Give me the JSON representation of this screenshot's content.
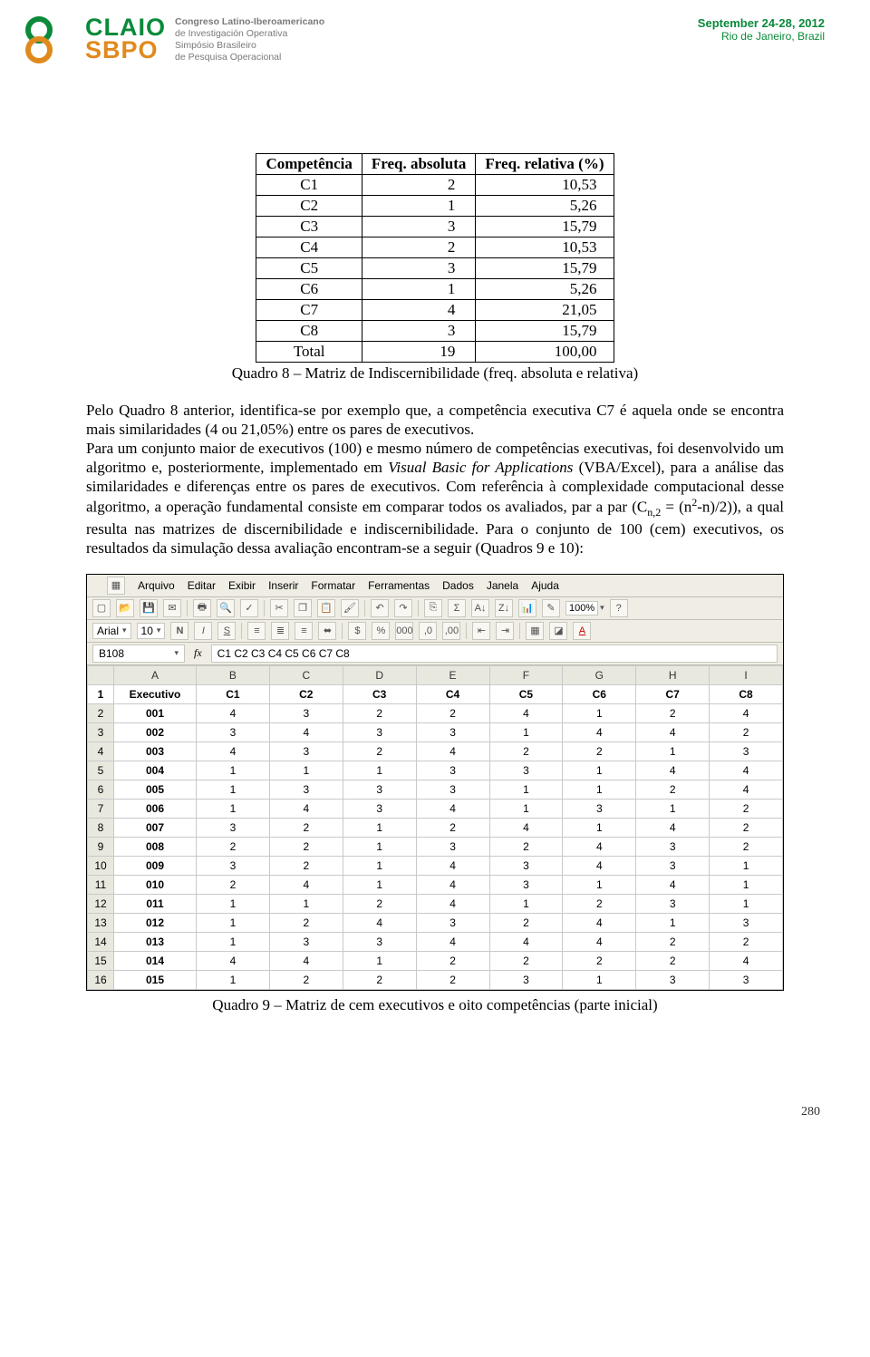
{
  "header": {
    "logo_line1": "CLAIO",
    "logo_line2": "SBPO",
    "sub1": "Congreso Latino-Iberoamericano",
    "sub2": "de Investigación Operativa",
    "sub3": "Simpósio Brasileiro",
    "sub4": "de Pesquisa Operacional",
    "date": "September 24-28, 2012",
    "location": "Rio de Janeiro, Brazil"
  },
  "freq_table": {
    "headers": [
      "Competência",
      "Freq. absoluta",
      "Freq. relativa (%)"
    ],
    "rows": [
      [
        "C1",
        "2",
        "10,53"
      ],
      [
        "C2",
        "1",
        "5,26"
      ],
      [
        "C3",
        "3",
        "15,79"
      ],
      [
        "C4",
        "2",
        "10,53"
      ],
      [
        "C5",
        "3",
        "15,79"
      ],
      [
        "C6",
        "1",
        "5,26"
      ],
      [
        "C7",
        "4",
        "21,05"
      ],
      [
        "C8",
        "3",
        "15,79"
      ],
      [
        "Total",
        "19",
        "100,00"
      ]
    ],
    "caption": "Quadro 8 – Matriz de Indiscernibilidade (freq. absoluta e relativa)"
  },
  "paragraph": {
    "p1a": "Pelo Quadro 8 anterior, identifica-se por exemplo que, a competência executiva C7 é aquela onde se encontra mais similaridades (4 ou 21,05%) entre os pares de executivos.",
    "p1b_pre": "Para um conjunto maior de executivos (100) e mesmo número de competências executivas, foi desenvolvido um algoritmo e, posteriormente, implementado em ",
    "p1b_em": "Visual Basic for Applications",
    "p1b_post": " (VBA/Excel), para a análise das similaridades e diferenças entre os pares de executivos. Com referência à complexidade computacional desse algoritmo, a operação fundamental consiste em comparar todos os avaliados, par a par (C",
    "p1b_sub": "n,2",
    "p1b_mid": " = (n",
    "p1b_sup": "2",
    "p1b_tail": "-n)/2)), a qual resulta nas matrizes de discernibilidade e indiscernibilidade. Para o conjunto de 100 (cem) executivos, os resultados da simulação dessa avaliação encontram-se a seguir (Quadros 9 e 10):"
  },
  "spreadsheet": {
    "menus": [
      "Arquivo",
      "Editar",
      "Exibir",
      "Inserir",
      "Formatar",
      "Ferramentas",
      "Dados",
      "Janela",
      "Ajuda"
    ],
    "font": "Arial",
    "size": "10",
    "zoom": "100%",
    "name_box": "B108",
    "formula": "C1 C2 C3 C4 C5 C6 C7 C8",
    "col_letters": [
      "",
      "A",
      "B",
      "C",
      "D",
      "E",
      "F",
      "G",
      "H",
      "I"
    ],
    "header_row": [
      "Executivo",
      "C1",
      "C2",
      "C3",
      "C4",
      "C5",
      "C6",
      "C7",
      "C8"
    ],
    "data_rows": [
      [
        "001",
        "4",
        "3",
        "2",
        "2",
        "4",
        "1",
        "2",
        "4"
      ],
      [
        "002",
        "3",
        "4",
        "3",
        "3",
        "1",
        "4",
        "4",
        "2"
      ],
      [
        "003",
        "4",
        "3",
        "2",
        "4",
        "2",
        "2",
        "1",
        "3"
      ],
      [
        "004",
        "1",
        "1",
        "1",
        "3",
        "3",
        "1",
        "4",
        "4"
      ],
      [
        "005",
        "1",
        "3",
        "3",
        "3",
        "1",
        "1",
        "2",
        "4"
      ],
      [
        "006",
        "1",
        "4",
        "3",
        "4",
        "1",
        "3",
        "1",
        "2"
      ],
      [
        "007",
        "3",
        "2",
        "1",
        "2",
        "4",
        "1",
        "4",
        "2"
      ],
      [
        "008",
        "2",
        "2",
        "1",
        "3",
        "2",
        "4",
        "3",
        "2"
      ],
      [
        "009",
        "3",
        "2",
        "1",
        "4",
        "3",
        "4",
        "3",
        "1"
      ],
      [
        "010",
        "2",
        "4",
        "1",
        "4",
        "3",
        "1",
        "4",
        "1"
      ],
      [
        "011",
        "1",
        "1",
        "2",
        "4",
        "1",
        "2",
        "3",
        "1"
      ],
      [
        "012",
        "1",
        "2",
        "4",
        "3",
        "2",
        "4",
        "1",
        "3"
      ],
      [
        "013",
        "1",
        "3",
        "3",
        "4",
        "4",
        "4",
        "2",
        "2"
      ],
      [
        "014",
        "4",
        "4",
        "1",
        "2",
        "2",
        "2",
        "2",
        "4"
      ],
      [
        "015",
        "1",
        "2",
        "2",
        "2",
        "3",
        "1",
        "3",
        "3"
      ]
    ],
    "caption": "Quadro 9 – Matriz de cem executivos e oito competências (parte inicial)"
  },
  "page_number": "280",
  "chart_data": {
    "type": "table",
    "title": "Quadro 8 – Matriz de Indiscernibilidade (freq. absoluta e relativa)",
    "columns": [
      "Competência",
      "Freq. absoluta",
      "Freq. relativa (%)"
    ],
    "rows": [
      {
        "Competência": "C1",
        "Freq. absoluta": 2,
        "Freq. relativa (%)": 10.53
      },
      {
        "Competência": "C2",
        "Freq. absoluta": 1,
        "Freq. relativa (%)": 5.26
      },
      {
        "Competência": "C3",
        "Freq. absoluta": 3,
        "Freq. relativa (%)": 15.79
      },
      {
        "Competência": "C4",
        "Freq. absoluta": 2,
        "Freq. relativa (%)": 10.53
      },
      {
        "Competência": "C5",
        "Freq. absoluta": 3,
        "Freq. relativa (%)": 15.79
      },
      {
        "Competência": "C6",
        "Freq. absoluta": 1,
        "Freq. relativa (%)": 5.26
      },
      {
        "Competência": "C7",
        "Freq. absoluta": 4,
        "Freq. relativa (%)": 21.05
      },
      {
        "Competência": "C8",
        "Freq. absoluta": 3,
        "Freq. relativa (%)": 15.79
      },
      {
        "Competência": "Total",
        "Freq. absoluta": 19,
        "Freq. relativa (%)": 100.0
      }
    ]
  }
}
